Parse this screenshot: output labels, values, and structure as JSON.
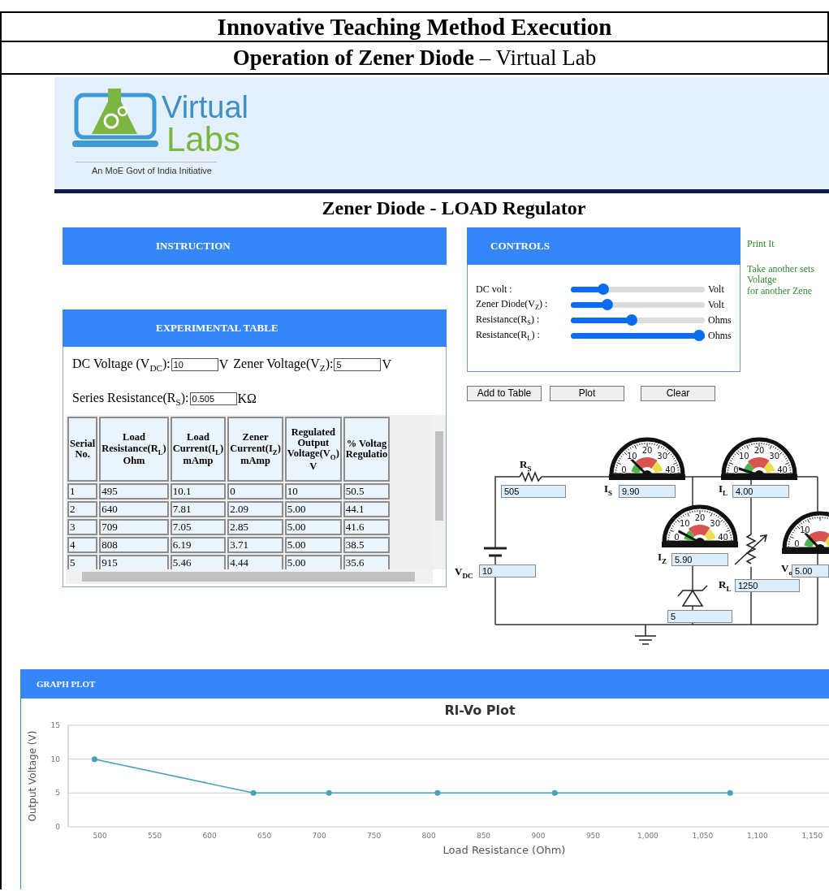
{
  "document": {
    "title": "Innovative Teaching Method Execution",
    "subtitle": "**Operation of Zener Diode** –  Virtual Lab"
  },
  "site": {
    "logo_top": "Virtual",
    "logo_bottom": "Labs",
    "tagline": "An MoE Govt of India Initiative"
  },
  "lab": {
    "title": "Zener Diode - LOAD Regulator"
  },
  "instruction": {
    "heading": "INSTRUCTION"
  },
  "experiment": {
    "heading": "EXPERIMENTAL TABLE",
    "fields": [
      {
        "label": "DC Voltage (V$_{DC}$):",
        "value": "10",
        "unit": "V"
      },
      {
        "label": "Zener Voltage(V$_{Z}$):",
        "value": "5",
        "unit": "V"
      },
      {
        "label": "Series Resistance(R$_{S}$):",
        "value": "0.505",
        "unit": "KΩ"
      }
    ],
    "table": {
      "columns": [
        "Serial\nNo.",
        "Load\nResistance(R$_{L}$)\nOhm",
        "Load\nCurrent(I$_{L}$)\nmAmp",
        "Zener\nCurrent(I$_{Z}$)\nmAmp",
        "Regulated\nOutput\nVoltage(V$_{O}$)\nV",
        "% Voltag\nRegulatio"
      ],
      "rows": [
        [
          "1",
          "495",
          "10.1",
          "0",
          "10",
          "50.5"
        ],
        [
          "2",
          "640",
          "7.81",
          "2.09",
          "5.00",
          "44.1"
        ],
        [
          "3",
          "709",
          "7.05",
          "2.85",
          "5.00",
          "41.6"
        ],
        [
          "4",
          "808",
          "6.19",
          "3.71",
          "5.00",
          "38.5"
        ],
        [
          "5",
          "915",
          "5.46",
          "4.44",
          "5.00",
          "35.6"
        ]
      ]
    }
  },
  "controls": {
    "heading": "CONTROLS",
    "sliders": [
      {
        "label": "DC volt :",
        "level": 0.22,
        "unit": "Volt"
      },
      {
        "label": "Zener Diode(V$_{Z}$) :",
        "level": 0.25,
        "unit": "Volt"
      },
      {
        "label": "Resistance(R$_{S}$) :",
        "level": 0.45,
        "unit": "Ohms"
      },
      {
        "label": "Resistance(R$_{L}$) :",
        "level": 1,
        "unit": "Ohms"
      }
    ]
  },
  "buttons": [
    "Add to Table",
    "Plot",
    "Clear"
  ],
  "notes": [
    "Print It",
    "Take another sets\nVolatge\nfor another Zene"
  ],
  "circuit": {
    "rs": {
      "label": "R$_{S}$",
      "value": "505"
    },
    "vdc": {
      "label": "V$_{DC}$",
      "value": "10"
    },
    "zener": {
      "value": "5"
    },
    "rl": {
      "label": "R$_{L}$",
      "value": "1250"
    },
    "meters": [
      {
        "label": "I$_{S}$",
        "value": "9.90",
        "scale": [
          "0",
          "10",
          "20",
          "30",
          "40"
        ]
      },
      {
        "label": "I$_{L}$",
        "value": "4.00",
        "scale": [
          "0",
          "10",
          "20",
          "30",
          "40"
        ]
      },
      {
        "label": "I$_{Z}$",
        "value": "5.90",
        "scale": [
          "0",
          "10",
          "20",
          "30",
          "40"
        ]
      },
      {
        "label": "V$_{o}$",
        "value": "5.00",
        "scale": [
          "0",
          "10"
        ]
      }
    ]
  },
  "graph": {
    "heading": "GRAPH PLOT",
    "chart_data": {
      "type": "line",
      "title": "Rl-Vo Plot",
      "xlabel": "Load Resistance (Ohm)",
      "ylabel": "Output Voltage (V)",
      "x": [
        495,
        640,
        709,
        808,
        915,
        1075
      ],
      "series": [
        {
          "color": "#45a3b5",
          "marker": "circle",
          "values": [
            10,
            5,
            5,
            5,
            5,
            5
          ]
        }
      ],
      "xlim": [
        471,
        1166
      ],
      "ylim": [
        0,
        15
      ],
      "xticks": [
        500,
        550,
        600,
        650,
        700,
        750,
        800,
        850,
        900,
        950,
        {
          "value": 1000,
          "label": "1,000"
        },
        {
          "value": 1050,
          "label": "1,050"
        },
        {
          "value": 1100,
          "label": "1,100"
        },
        {
          "value": 1150,
          "label": "1,150"
        }
      ],
      "yticks": [
        0,
        5,
        10,
        15
      ]
    }
  }
}
